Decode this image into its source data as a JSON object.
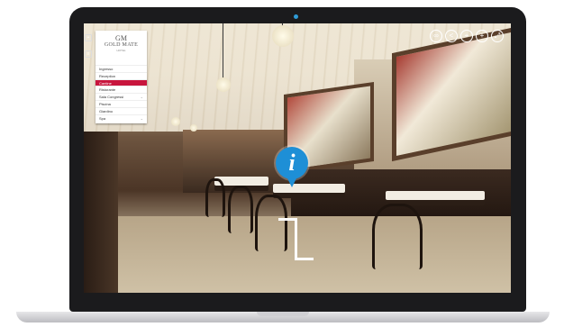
{
  "menu": {
    "logo": {
      "mark": "GM",
      "name": "GOLD MATE",
      "sub": "HOTEL"
    },
    "items": [
      {
        "label": "Ingresso",
        "active": false,
        "expandable": false
      },
      {
        "label": "Reception",
        "active": false,
        "expandable": false
      },
      {
        "label": "Cantine",
        "active": true,
        "expandable": false
      },
      {
        "label": "Ristorante",
        "active": false,
        "expandable": false
      },
      {
        "label": "Sala Congressi",
        "active": false,
        "expandable": true
      },
      {
        "label": "Piscina",
        "active": false,
        "expandable": false
      },
      {
        "label": "Giardino",
        "active": false,
        "expandable": false
      },
      {
        "label": "Spa",
        "active": false,
        "expandable": true
      }
    ]
  },
  "top_icons": [
    "vr-icon",
    "share-icon",
    "location-icon",
    "zoom-in-icon",
    "fullscreen-icon"
  ],
  "left_tools": [
    "expand-icon",
    "menu-toggle-icon"
  ],
  "hotspot": {
    "info_glyph": "i"
  },
  "colors": {
    "accent": "#c8153d",
    "hotspot": "#1e8fd6",
    "bezel": "#1b1b1d"
  }
}
